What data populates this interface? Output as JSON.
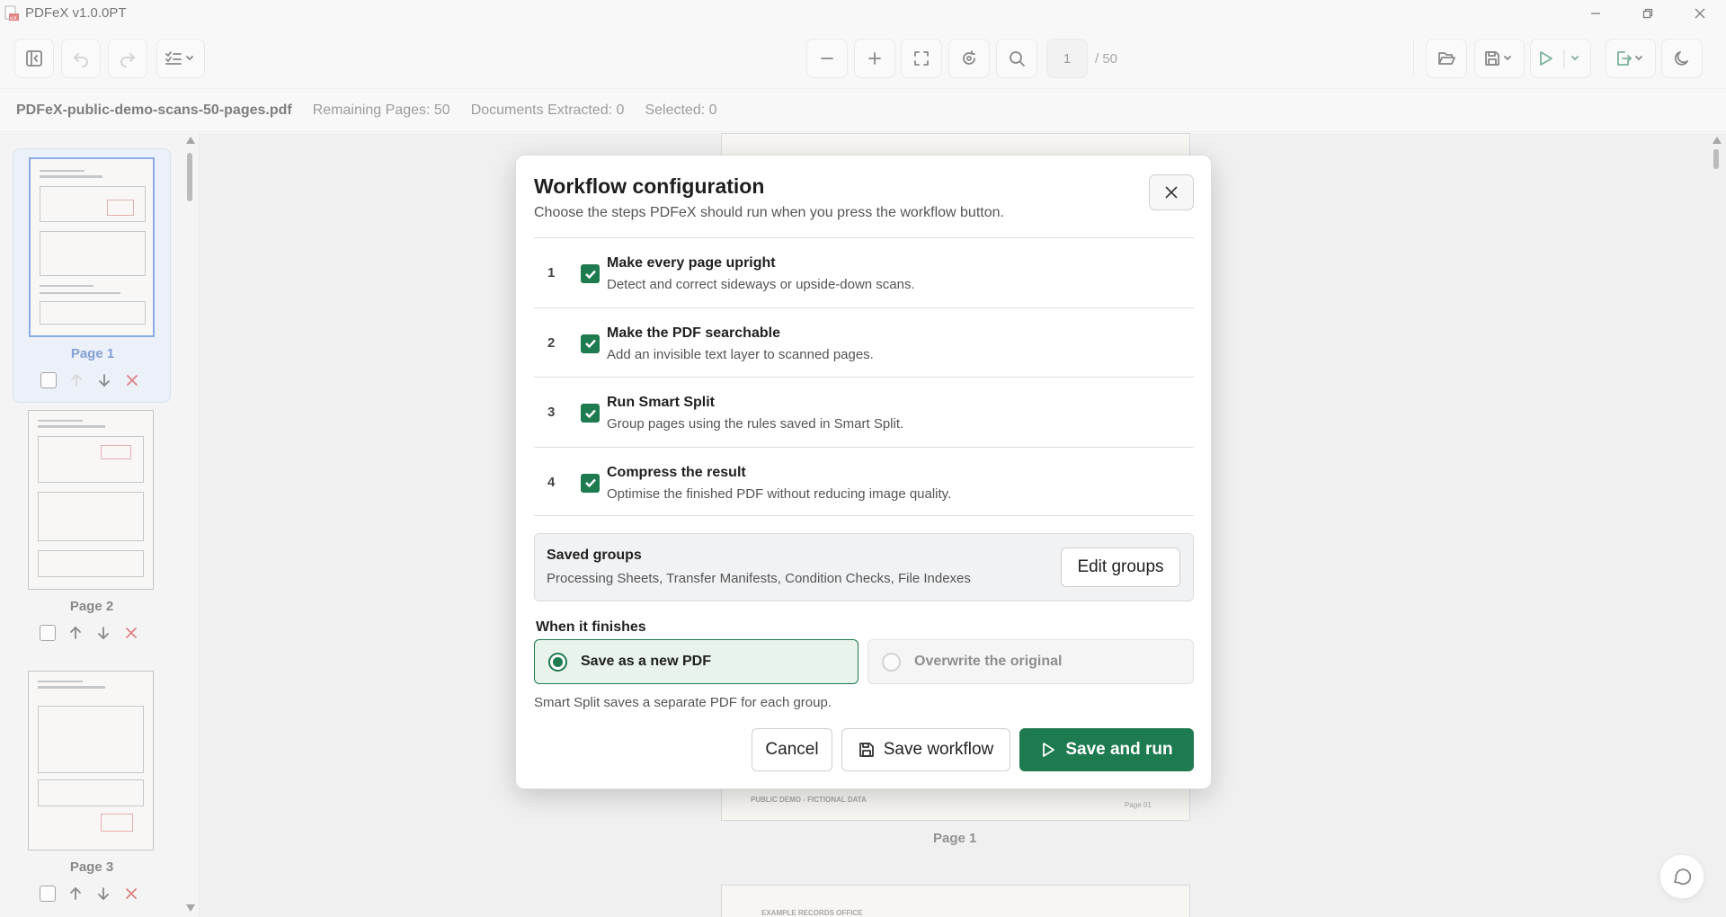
{
  "app": {
    "title": "PDFeX v1.0.0PT"
  },
  "toolbar": {
    "page_number": "1",
    "page_total": "/ 50"
  },
  "info_bar": {
    "file_name": "PDFeX-public-demo-scans-50-pages.pdf",
    "remaining": "Remaining Pages: 50",
    "extracted": "Documents Extracted: 0",
    "selected": "Selected: 0"
  },
  "sidebar": {
    "pages": [
      {
        "label": "Page 1",
        "active": true
      },
      {
        "label": "Page 2",
        "active": false
      },
      {
        "label": "Page 3",
        "active": false
      }
    ]
  },
  "viewer": {
    "preview_footer_left": "PUBLIC DEMO - FICTIONAL DATA",
    "preview_footer_right": "Page 01",
    "page_caption": "Page 1",
    "next_page_header": "EXAMPLE RECORDS OFFICE"
  },
  "modal": {
    "title": "Workflow configuration",
    "subtitle": "Choose the steps PDFeX should run when you press the workflow button.",
    "steps": [
      {
        "number": "1",
        "title": "Make every page upright",
        "description": "Detect and correct sideways or upside-down scans.",
        "checked": true
      },
      {
        "number": "2",
        "title": "Make the PDF searchable",
        "description": "Add an invisible text layer to scanned pages.",
        "checked": true
      },
      {
        "number": "3",
        "title": "Run Smart Split",
        "description": "Group pages using the rules saved in Smart Split.",
        "checked": true
      },
      {
        "number": "4",
        "title": "Compress the result",
        "description": "Optimise the finished PDF without reducing image quality.",
        "checked": true
      }
    ],
    "saved_groups": {
      "title": "Saved groups",
      "list": "Processing Sheets, Transfer Manifests, Condition Checks, File Indexes",
      "edit_label": "Edit groups"
    },
    "when_finishes": {
      "label": "When it finishes",
      "options": [
        {
          "label": "Save as a new PDF",
          "selected": true
        },
        {
          "label": "Overwrite the original",
          "selected": false,
          "disabled": true
        }
      ],
      "note": "Smart Split saves a separate PDF for each group."
    },
    "buttons": {
      "cancel": "Cancel",
      "save_workflow": "Save workflow",
      "save_and_run": "Save and run"
    }
  },
  "colors": {
    "accent": "#1e7a4f",
    "selection_blue": "#3b6fd1"
  }
}
